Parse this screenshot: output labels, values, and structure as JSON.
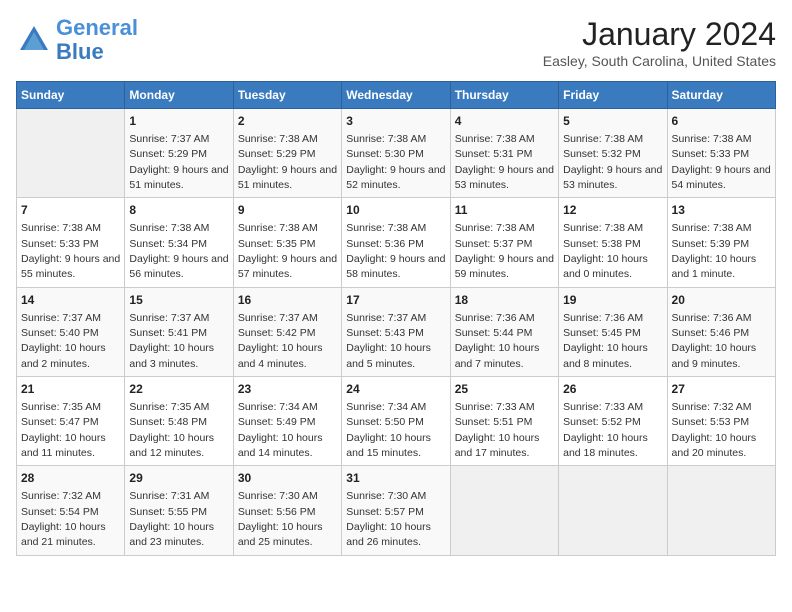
{
  "header": {
    "logo_line1": "General",
    "logo_line2": "Blue",
    "month": "January 2024",
    "location": "Easley, South Carolina, United States"
  },
  "weekdays": [
    "Sunday",
    "Monday",
    "Tuesday",
    "Wednesday",
    "Thursday",
    "Friday",
    "Saturday"
  ],
  "weeks": [
    [
      {
        "day": "",
        "empty": true
      },
      {
        "day": "1",
        "sunrise": "7:37 AM",
        "sunset": "5:29 PM",
        "daylight": "9 hours and 51 minutes."
      },
      {
        "day": "2",
        "sunrise": "7:38 AM",
        "sunset": "5:29 PM",
        "daylight": "9 hours and 51 minutes."
      },
      {
        "day": "3",
        "sunrise": "7:38 AM",
        "sunset": "5:30 PM",
        "daylight": "9 hours and 52 minutes."
      },
      {
        "day": "4",
        "sunrise": "7:38 AM",
        "sunset": "5:31 PM",
        "daylight": "9 hours and 53 minutes."
      },
      {
        "day": "5",
        "sunrise": "7:38 AM",
        "sunset": "5:32 PM",
        "daylight": "9 hours and 53 minutes."
      },
      {
        "day": "6",
        "sunrise": "7:38 AM",
        "sunset": "5:33 PM",
        "daylight": "9 hours and 54 minutes."
      }
    ],
    [
      {
        "day": "7",
        "sunrise": "7:38 AM",
        "sunset": "5:33 PM",
        "daylight": "9 hours and 55 minutes."
      },
      {
        "day": "8",
        "sunrise": "7:38 AM",
        "sunset": "5:34 PM",
        "daylight": "9 hours and 56 minutes."
      },
      {
        "day": "9",
        "sunrise": "7:38 AM",
        "sunset": "5:35 PM",
        "daylight": "9 hours and 57 minutes."
      },
      {
        "day": "10",
        "sunrise": "7:38 AM",
        "sunset": "5:36 PM",
        "daylight": "9 hours and 58 minutes."
      },
      {
        "day": "11",
        "sunrise": "7:38 AM",
        "sunset": "5:37 PM",
        "daylight": "9 hours and 59 minutes."
      },
      {
        "day": "12",
        "sunrise": "7:38 AM",
        "sunset": "5:38 PM",
        "daylight": "10 hours and 0 minutes."
      },
      {
        "day": "13",
        "sunrise": "7:38 AM",
        "sunset": "5:39 PM",
        "daylight": "10 hours and 1 minute."
      }
    ],
    [
      {
        "day": "14",
        "sunrise": "7:37 AM",
        "sunset": "5:40 PM",
        "daylight": "10 hours and 2 minutes."
      },
      {
        "day": "15",
        "sunrise": "7:37 AM",
        "sunset": "5:41 PM",
        "daylight": "10 hours and 3 minutes."
      },
      {
        "day": "16",
        "sunrise": "7:37 AM",
        "sunset": "5:42 PM",
        "daylight": "10 hours and 4 minutes."
      },
      {
        "day": "17",
        "sunrise": "7:37 AM",
        "sunset": "5:43 PM",
        "daylight": "10 hours and 5 minutes."
      },
      {
        "day": "18",
        "sunrise": "7:36 AM",
        "sunset": "5:44 PM",
        "daylight": "10 hours and 7 minutes."
      },
      {
        "day": "19",
        "sunrise": "7:36 AM",
        "sunset": "5:45 PM",
        "daylight": "10 hours and 8 minutes."
      },
      {
        "day": "20",
        "sunrise": "7:36 AM",
        "sunset": "5:46 PM",
        "daylight": "10 hours and 9 minutes."
      }
    ],
    [
      {
        "day": "21",
        "sunrise": "7:35 AM",
        "sunset": "5:47 PM",
        "daylight": "10 hours and 11 minutes."
      },
      {
        "day": "22",
        "sunrise": "7:35 AM",
        "sunset": "5:48 PM",
        "daylight": "10 hours and 12 minutes."
      },
      {
        "day": "23",
        "sunrise": "7:34 AM",
        "sunset": "5:49 PM",
        "daylight": "10 hours and 14 minutes."
      },
      {
        "day": "24",
        "sunrise": "7:34 AM",
        "sunset": "5:50 PM",
        "daylight": "10 hours and 15 minutes."
      },
      {
        "day": "25",
        "sunrise": "7:33 AM",
        "sunset": "5:51 PM",
        "daylight": "10 hours and 17 minutes."
      },
      {
        "day": "26",
        "sunrise": "7:33 AM",
        "sunset": "5:52 PM",
        "daylight": "10 hours and 18 minutes."
      },
      {
        "day": "27",
        "sunrise": "7:32 AM",
        "sunset": "5:53 PM",
        "daylight": "10 hours and 20 minutes."
      }
    ],
    [
      {
        "day": "28",
        "sunrise": "7:32 AM",
        "sunset": "5:54 PM",
        "daylight": "10 hours and 21 minutes."
      },
      {
        "day": "29",
        "sunrise": "7:31 AM",
        "sunset": "5:55 PM",
        "daylight": "10 hours and 23 minutes."
      },
      {
        "day": "30",
        "sunrise": "7:30 AM",
        "sunset": "5:56 PM",
        "daylight": "10 hours and 25 minutes."
      },
      {
        "day": "31",
        "sunrise": "7:30 AM",
        "sunset": "5:57 PM",
        "daylight": "10 hours and 26 minutes."
      },
      {
        "day": "",
        "empty": true
      },
      {
        "day": "",
        "empty": true
      },
      {
        "day": "",
        "empty": true
      }
    ]
  ]
}
